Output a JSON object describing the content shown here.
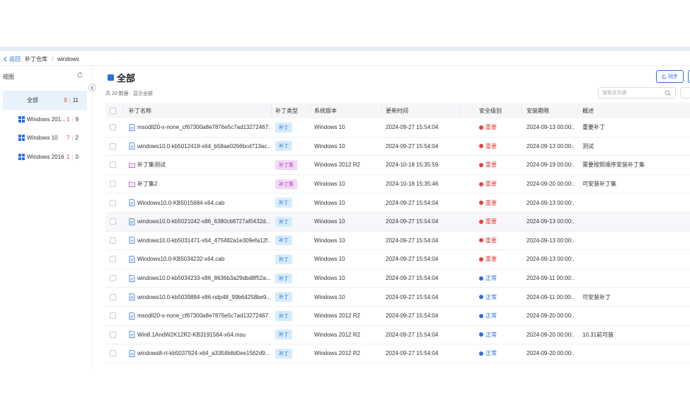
{
  "breadcrumb": {
    "back": "返回",
    "parent": "补丁仓库",
    "sep": "/",
    "current": "windows"
  },
  "sidebar": {
    "title": "视图",
    "items": [
      {
        "name": "全部",
        "red": "9",
        "total": "11",
        "icon": "none",
        "active": true
      },
      {
        "name": "Windows 201...",
        "red": "1",
        "total": "9",
        "icon": "windows-icon",
        "active": false
      },
      {
        "name": "Windows 10",
        "red": "7",
        "total": "2",
        "icon": "windows-icon",
        "active": false
      },
      {
        "name": "Windows 2016",
        "red": "1",
        "total": "0",
        "icon": "windows-icon",
        "active": false
      }
    ]
  },
  "main": {
    "title": "全部",
    "sync_label": "同步",
    "count_text": "共 20 数据 · 显示全部",
    "search_placeholder": "搜索此列表"
  },
  "table": {
    "headers": {
      "name": "补丁名称",
      "type": "补丁类型",
      "os": "系统版本",
      "time": "更新时间",
      "level": "安全级别",
      "install": "安装期限",
      "desc": "概述"
    },
    "rows": [
      {
        "name": "msodll20-x-none_cf67300a8e7876e5c7ad13272467...",
        "type": "补丁",
        "kind": "patch",
        "os": "Windows 10",
        "time": "2024-09-27 15:54:04",
        "level": "重要",
        "lv": "red",
        "install": "2024-09-13 00:00:...",
        "desc": "重要补丁"
      },
      {
        "name": "windows10.0-kb5012419-x64_b58ae0266bcd713ac...",
        "type": "补丁",
        "kind": "patch",
        "os": "Windows 10",
        "time": "2024-09-27 15:54:04",
        "level": "重要",
        "lv": "red",
        "install": "2024-09-13 00:00:...",
        "desc": "测试"
      },
      {
        "name": "补丁集测试",
        "type": "补丁集",
        "kind": "set",
        "os": "Windows 2012 R2",
        "time": "2024-10-18 15:35:59",
        "level": "重要",
        "lv": "red",
        "install": "2024-09-19 00:00:...",
        "desc": "需要按照顺序安装补丁集"
      },
      {
        "name": "补丁集2",
        "type": "补丁集",
        "kind": "set",
        "os": "Windows 10",
        "time": "2024-10-18 15:35:46",
        "level": "重要",
        "lv": "red",
        "install": "2024-09-20 00:00:...",
        "desc": "可安装补丁集"
      },
      {
        "name": "Windows10.0-KB5015684-x64.cab",
        "type": "补丁",
        "kind": "patch",
        "os": "Windows 10",
        "time": "2024-09-27 15:54:04",
        "level": "重要",
        "lv": "red",
        "install": "2024-09-13 00:00:...",
        "desc": ""
      },
      {
        "name": "windows10.0-kb5021042-x86_6380cb8727af0432d...",
        "type": "补丁",
        "kind": "patch",
        "os": "Windows 10",
        "time": "2024-09-27 15:54:04",
        "level": "重要",
        "lv": "red",
        "install": "2024-09-13 00:00:...",
        "desc": ""
      },
      {
        "name": "windows10.0-kb5031471-x64_475482a1e309efa12f...",
        "type": "补丁",
        "kind": "patch",
        "os": "Windows 10",
        "time": "2024-09-27 15:54:04",
        "level": "重要",
        "lv": "red",
        "install": "2024-09-13 00:00:...",
        "desc": ""
      },
      {
        "name": "Windows10.0-KB5034232-x64.cab",
        "type": "补丁",
        "kind": "patch",
        "os": "Windows 10",
        "time": "2024-09-27 15:54:04",
        "level": "重要",
        "lv": "red",
        "install": "2024-09-13 00:00:...",
        "desc": ""
      },
      {
        "name": "windows10.0-kb5034233-x86_8636b3a29dbd8f52a...",
        "type": "补丁",
        "kind": "patch",
        "os": "Windows 10",
        "time": "2024-09-27 15:54:04",
        "level": "正常",
        "lv": "blue",
        "install": "2024-09-11 00:00:...",
        "desc": ""
      },
      {
        "name": "windows10.0-kb5039884-x86-ndp48_99b64258be9...",
        "type": "补丁",
        "kind": "patch",
        "os": "Windows 10",
        "time": "2024-09-27 15:54:04",
        "level": "正常",
        "lv": "blue",
        "install": "2024-09-11 00:00:...",
        "desc": "可安装补丁"
      },
      {
        "name": "msodll20-x-none_cf67300a8e7876e5c7ad13272467...",
        "type": "补丁",
        "kind": "patch",
        "os": "Windows 2012 R2",
        "time": "2024-09-27 15:54:04",
        "level": "正常",
        "lv": "blue",
        "install": "2024-09-20 00:00:...",
        "desc": ""
      },
      {
        "name": "Win8.1AndW2K12R2-KB3191564-x64.msu",
        "type": "补丁",
        "kind": "patch",
        "os": "Windows 2012 R2",
        "time": "2024-09-27 15:54:04",
        "level": "正常",
        "lv": "blue",
        "install": "2024-09-20 00:00:...",
        "desc": "10.31前可装"
      },
      {
        "name": "windows8-rt-kb5037924-x64_a3354b8d0ee1562d9...",
        "type": "补丁",
        "kind": "patch",
        "os": "Windows 2012 R2",
        "time": "2024-09-27 15:54:04",
        "level": "正常",
        "lv": "blue",
        "install": "2024-09-20 00:00:...",
        "desc": ""
      }
    ]
  },
  "colors": {
    "accent": "#2b6fe0",
    "important": "#e5413a",
    "set_tag": "#b043c6"
  }
}
